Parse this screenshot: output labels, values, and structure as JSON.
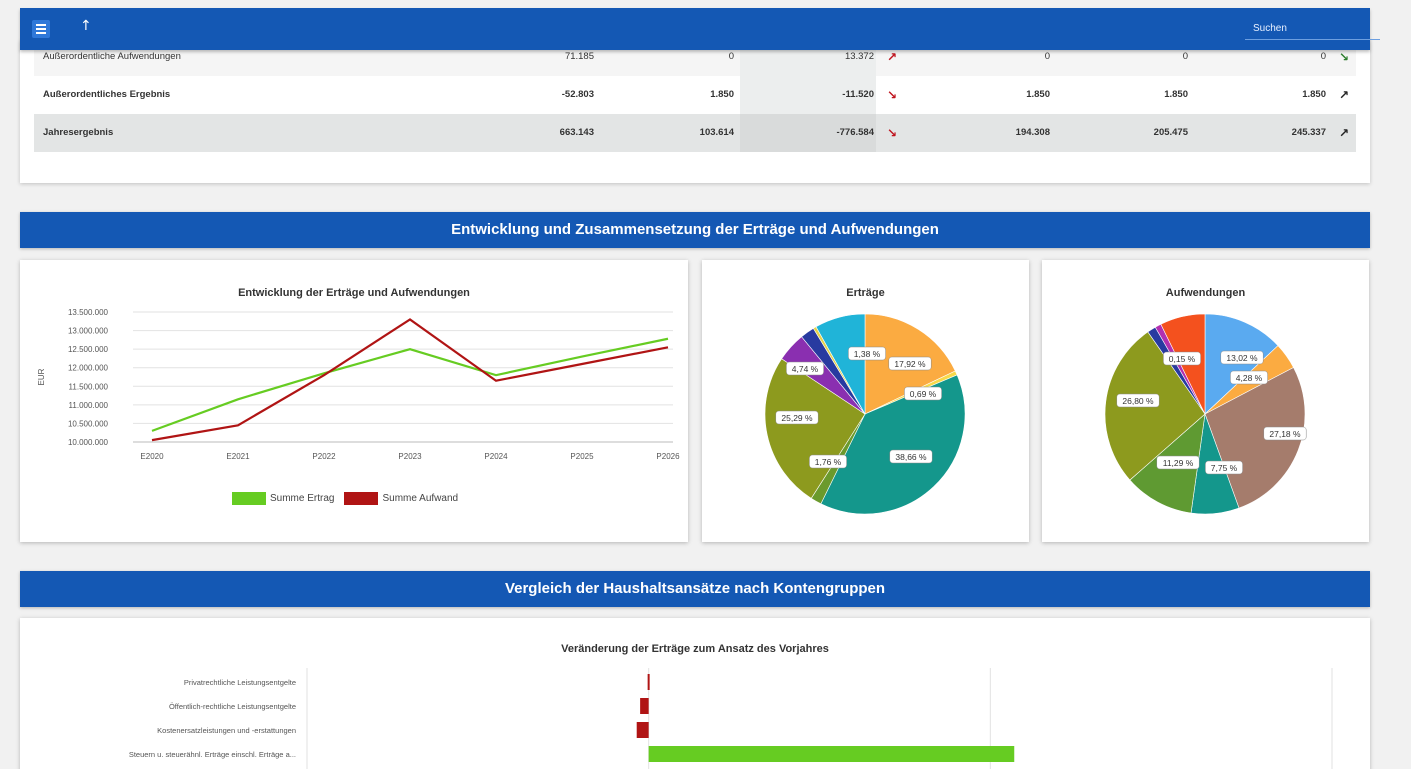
{
  "topbar": {
    "search_placeholder": "Suchen"
  },
  "table": {
    "rows": [
      {
        "label": "Außerordentliche Aufwendungen",
        "bold": false,
        "values": [
          "71.185",
          "0",
          "13.372",
          "0",
          "0",
          "0"
        ],
        "trend_mid": "up",
        "trend_end": "down-right"
      },
      {
        "label": "Außerordentliches Ergebnis",
        "bold": true,
        "values": [
          "-52.803",
          "1.850",
          "-11.520",
          "1.850",
          "1.850",
          "1.850"
        ],
        "trend_mid": "down",
        "trend_end": "up-right"
      },
      {
        "label": "Jahresergebnis",
        "bold": true,
        "values": [
          "663.143",
          "103.614",
          "-776.584",
          "194.308",
          "205.475",
          "245.337"
        ],
        "trend_mid": "down",
        "trend_end": "up-right"
      }
    ]
  },
  "section1": {
    "title": "Entwicklung und Zusammensetzung der Erträge und Aufwendungen"
  },
  "section2": {
    "title": "Vergleich der Haushaltsansätze nach Kontengruppen"
  },
  "colors": {
    "brand": "#1458b4",
    "ertrag": "#66cc22",
    "aufwand": "#b01414",
    "trend_red": "#c0141e",
    "trend_green": "#2d7d2d"
  },
  "chart_data": [
    {
      "type": "line",
      "title": "Entwicklung der Erträge und Aufwendungen",
      "xlabel": "",
      "ylabel": "EUR",
      "categories": [
        "E2020",
        "E2021",
        "P2022",
        "P2023",
        "P2024",
        "P2025",
        "P2026"
      ],
      "y_ticks": [
        "10.000.000",
        "10.500.000",
        "11.000.000",
        "11.500.000",
        "12.000.000",
        "12.500.000",
        "13.000.000",
        "13.500.000"
      ],
      "ylim": [
        10000000,
        13500000
      ],
      "series": [
        {
          "name": "Summe Ertrag",
          "color": "#66cc22",
          "values": [
            10300000,
            11150000,
            11850000,
            12500000,
            11800000,
            12300000,
            12780000
          ]
        },
        {
          "name": "Summe Aufwand",
          "color": "#b01414",
          "values": [
            10050000,
            10450000,
            11800000,
            13300000,
            11650000,
            12100000,
            12550000
          ]
        }
      ],
      "grid": true,
      "legend": "bottom"
    },
    {
      "type": "pie",
      "title": "Erträge",
      "slices": [
        {
          "label": "17,92 %",
          "value": 17.92,
          "color": "#fbab41"
        },
        {
          "label": "0,69 %",
          "value": 0.69,
          "color": "#f7d94a"
        },
        {
          "label": "38,66 %",
          "value": 38.66,
          "color": "#14978c"
        },
        {
          "label": "1,76 %",
          "value": 1.76,
          "color": "#6b9a2c"
        },
        {
          "label": "25,29 %",
          "value": 25.29,
          "color": "#8d9a1e"
        },
        {
          "label": "4,74 %",
          "value": 4.74,
          "color": "#8a2fb0"
        },
        {
          "label": "2,3 %",
          "value": 2.3,
          "color": "#283aa0"
        },
        {
          "label": "0,5 %",
          "value": 0.5,
          "color": "#e6d24a"
        },
        {
          "label": "1,38 %",
          "value": 8.14,
          "color": "#20b4d8"
        }
      ],
      "visible_labels": [
        "17,92 %",
        "0,69 %",
        "38,66 %",
        "1,76 %",
        "25,29 %",
        "4,74 %",
        "1,38 %"
      ]
    },
    {
      "type": "pie",
      "title": "Aufwendungen",
      "slices": [
        {
          "label": "13,02 %",
          "value": 13.02,
          "color": "#5aaaf0"
        },
        {
          "label": "4,28 %",
          "value": 4.28,
          "color": "#fbab41"
        },
        {
          "label": "27,18 %",
          "value": 27.18,
          "color": "#a57c6c"
        },
        {
          "label": "7,75 %",
          "value": 7.75,
          "color": "#14978c"
        },
        {
          "label": "11,29 %",
          "value": 11.29,
          "color": "#5f9a32"
        },
        {
          "label": "26,80 %",
          "value": 26.8,
          "color": "#8d9a1e"
        },
        {
          "label": "0,15 %",
          "value": 1.4,
          "color": "#283aa0"
        },
        {
          "label": "",
          "value": 1.0,
          "color": "#b22fb0"
        },
        {
          "label": "",
          "value": 7.28,
          "color": "#f4511e"
        }
      ],
      "visible_labels": [
        "13,02 %",
        "4,28 %",
        "27,18 %",
        "7,75 %",
        "11,29 %",
        "26,80 %",
        "0,15 %"
      ]
    },
    {
      "type": "bar",
      "orientation": "horizontal",
      "title": "Veränderung der Erträge zum Ansatz des Vorjahres",
      "categories": [
        "Privatrechtliche Leistungsentgelte",
        "Öffentlich-rechtliche Leistungsentgelte",
        "Kostenersatzleistungen und -erstattungen",
        "Steuern u. steuerähnl. Erträge einschl. Erträge a..."
      ],
      "values": [
        -0.3,
        -2.5,
        -3.5,
        107
      ],
      "xlim": [
        -100,
        200
      ],
      "colors_negative": "#b01414",
      "colors_positive": "#66cc22"
    }
  ]
}
